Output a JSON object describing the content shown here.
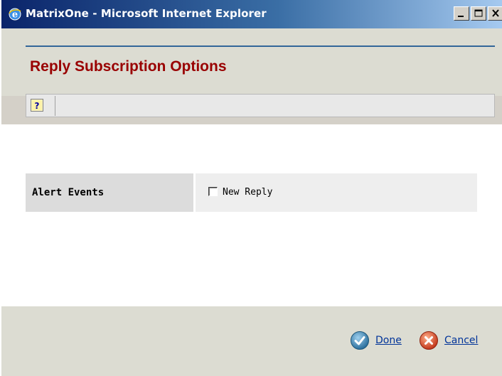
{
  "window": {
    "title": "MatrixOne - Microsoft Internet Explorer"
  },
  "page": {
    "title": "Reply Subscription Options"
  },
  "toolbar": {
    "help_icon": "help-icon"
  },
  "form": {
    "row_label": "Alert Events",
    "option_label": "New Reply",
    "option_checked": false
  },
  "actions": {
    "done_label": "Done",
    "cancel_label": "Cancel"
  },
  "colors": {
    "title_red": "#990000",
    "link_blue": "#003399",
    "rule_blue": "#336699",
    "done_icon": "#3c86b6",
    "cancel_icon": "#d9532c"
  }
}
